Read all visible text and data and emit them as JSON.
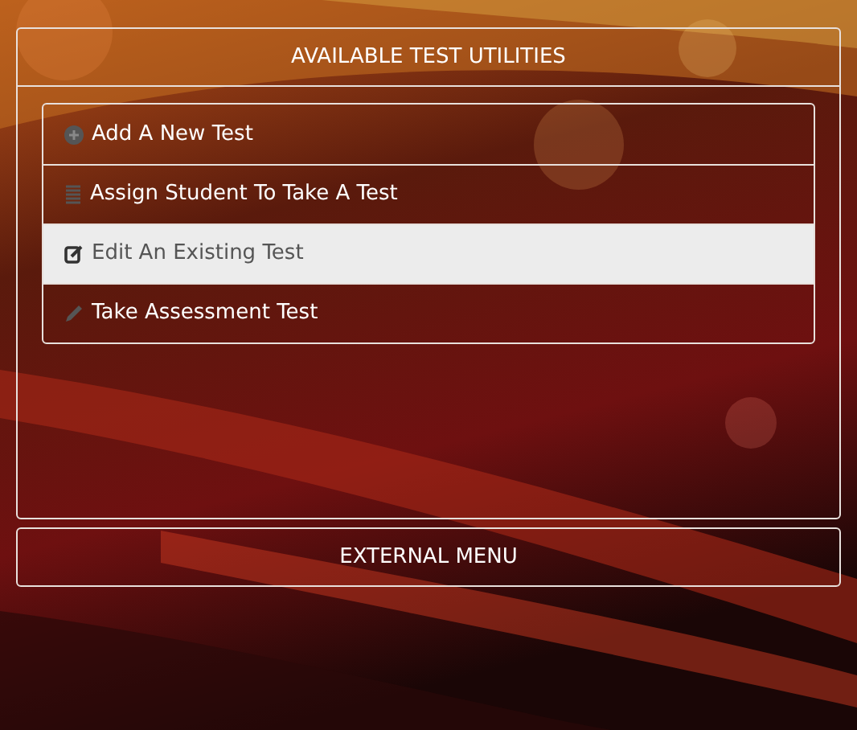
{
  "panel": {
    "title": "AVAILABLE TEST UTILITIES",
    "items": [
      {
        "label": "Add A New Test",
        "kind": "plus",
        "selected": false
      },
      {
        "label": "Assign Student To Take A Test",
        "kind": "list",
        "selected": false
      },
      {
        "label": "Edit An Existing Test",
        "kind": "edit",
        "selected": true
      },
      {
        "label": "Take Assessment Test",
        "kind": "pencil",
        "selected": false
      }
    ]
  },
  "external_menu": {
    "title": "EXTERNAL MENU"
  }
}
